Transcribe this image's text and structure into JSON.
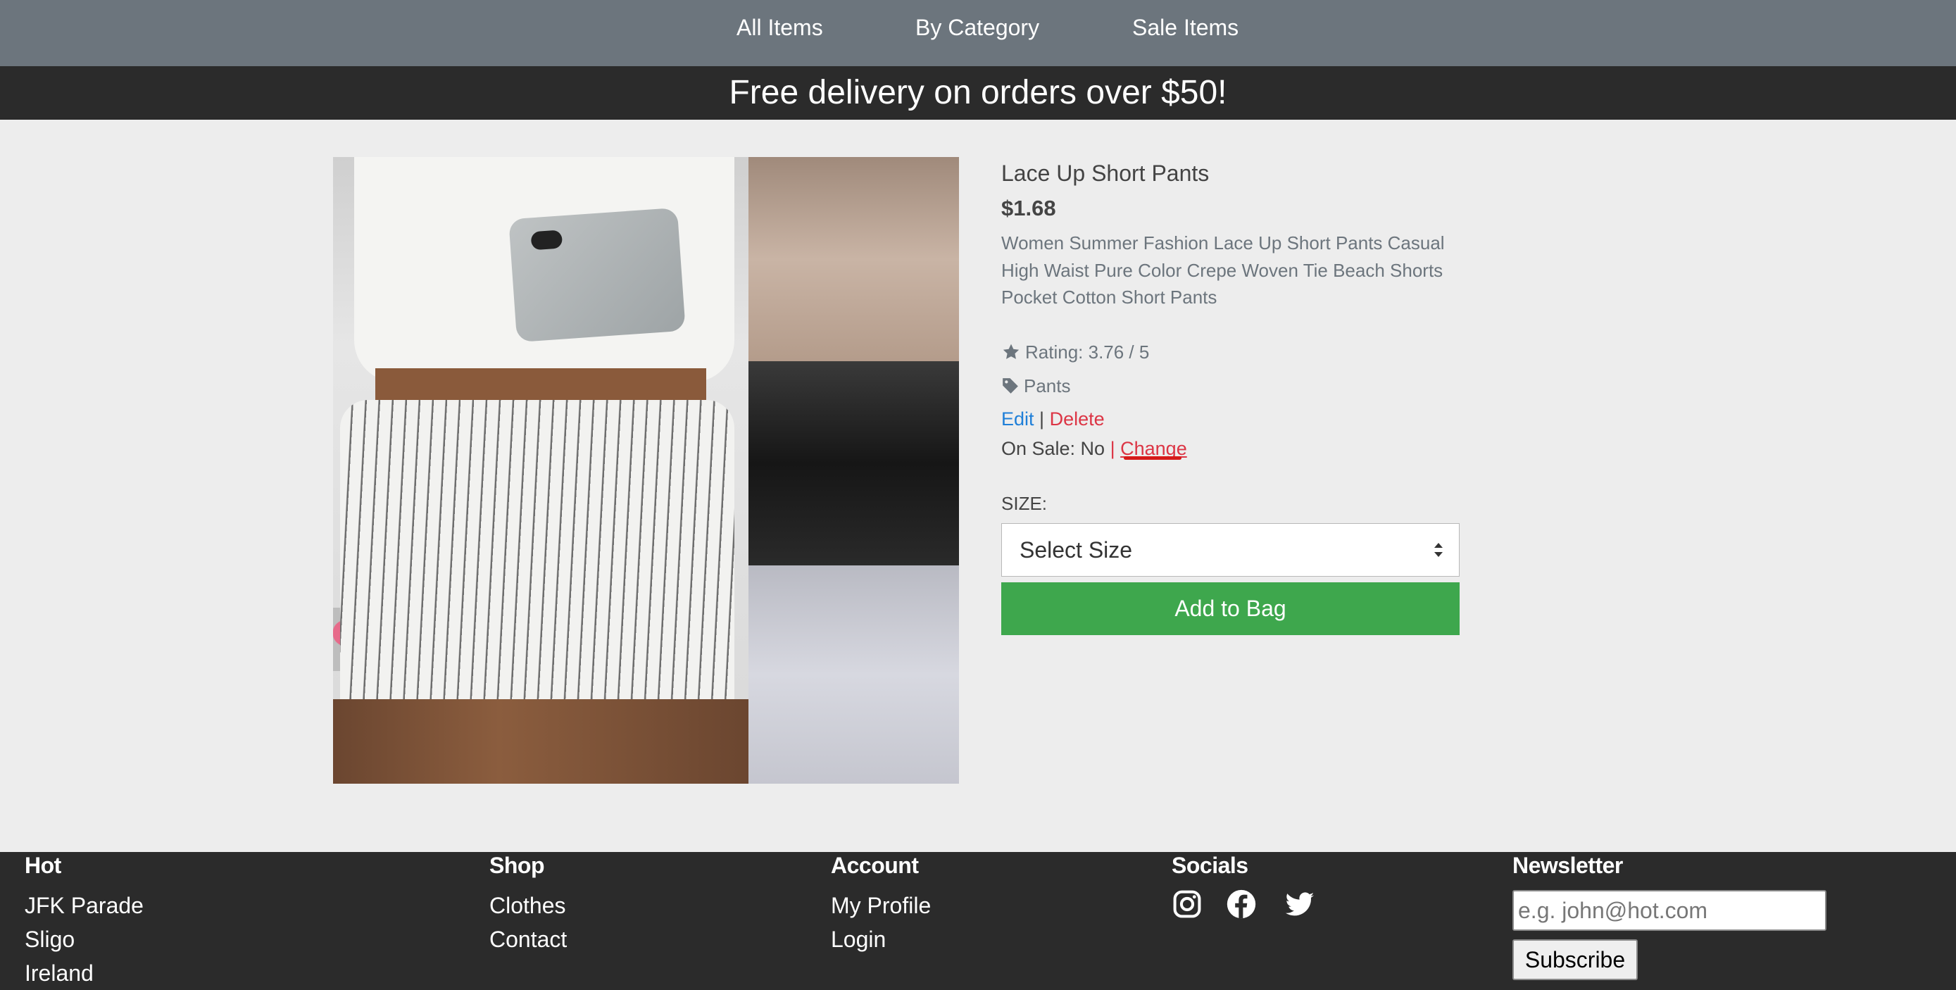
{
  "nav": {
    "items": [
      {
        "label": "All Items"
      },
      {
        "label": "By Category"
      },
      {
        "label": "Sale Items"
      }
    ]
  },
  "banner": {
    "text": "Free delivery on orders over $50!"
  },
  "product": {
    "title": "Lace Up Short Pants",
    "price": "$1.68",
    "description": "Women Summer Fashion Lace Up Short Pants Casual High Waist Pure Color Crepe Woven Tie Beach Shorts Pocket Cotton Short Pants",
    "rating_text": "Rating: 3.76 / 5",
    "category": "Pants",
    "actions": {
      "edit": "Edit",
      "separator": "|",
      "delete": "Delete"
    },
    "on_sale": {
      "label": "On Sale: No",
      "separator": "|",
      "change": "Change"
    },
    "size": {
      "label": "SIZE:",
      "selected": "Select Size"
    },
    "add_to_bag": "Add to Bag"
  },
  "footer": {
    "hot": {
      "heading": "Hot",
      "links": [
        "JFK Parade",
        "Sligo",
        "Ireland"
      ]
    },
    "shop": {
      "heading": "Shop",
      "links": [
        "Clothes",
        "Contact"
      ]
    },
    "account": {
      "heading": "Account",
      "links": [
        "My Profile",
        "Login"
      ]
    },
    "socials": {
      "heading": "Socials",
      "icons": [
        "instagram-icon",
        "facebook-icon",
        "twitter-icon"
      ]
    },
    "newsletter": {
      "heading": "Newsletter",
      "placeholder": "e.g. john@hot.com",
      "button": "Subscribe"
    }
  },
  "colors": {
    "nav_bg": "#6c757d",
    "banner_bg": "#2b2b2b",
    "page_bg": "#ededed",
    "button_green": "#3ea74d",
    "link_blue": "#1f7fd8",
    "link_red": "#dc3545"
  }
}
